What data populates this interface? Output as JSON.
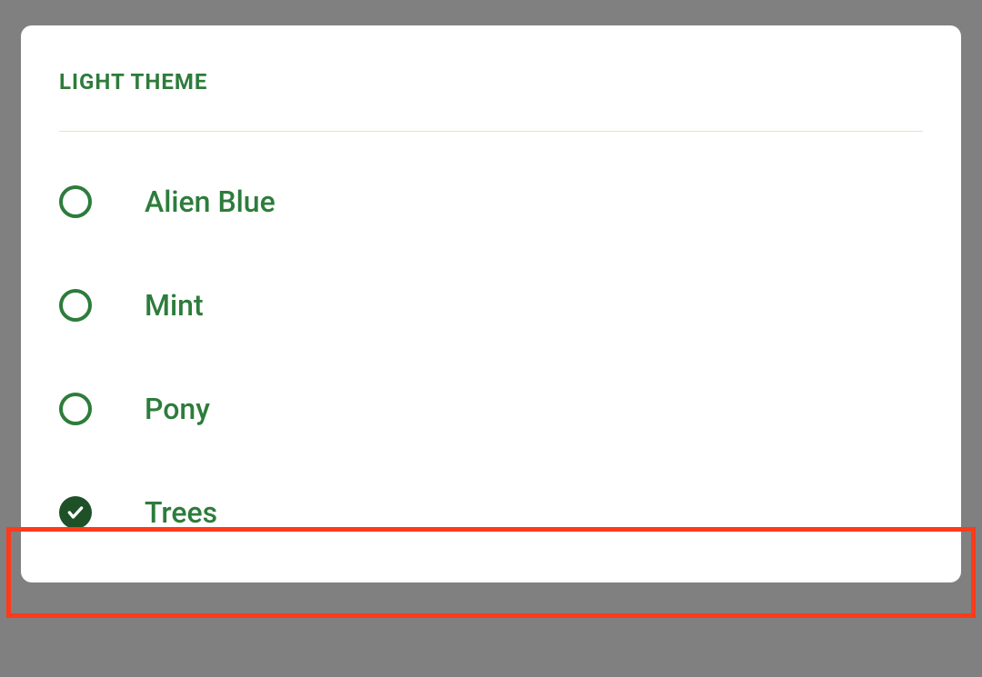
{
  "dialog": {
    "title": "LIGHT THEME",
    "options": [
      {
        "label": "Alien Blue",
        "selected": false
      },
      {
        "label": "Mint",
        "selected": false
      },
      {
        "label": "Pony",
        "selected": false
      },
      {
        "label": "Trees",
        "selected": true
      }
    ],
    "highlighted_index": 3
  },
  "colors": {
    "accent": "#2d7c3b",
    "accent_dark": "#1e5128",
    "highlight_border": "#ff3a1a"
  }
}
